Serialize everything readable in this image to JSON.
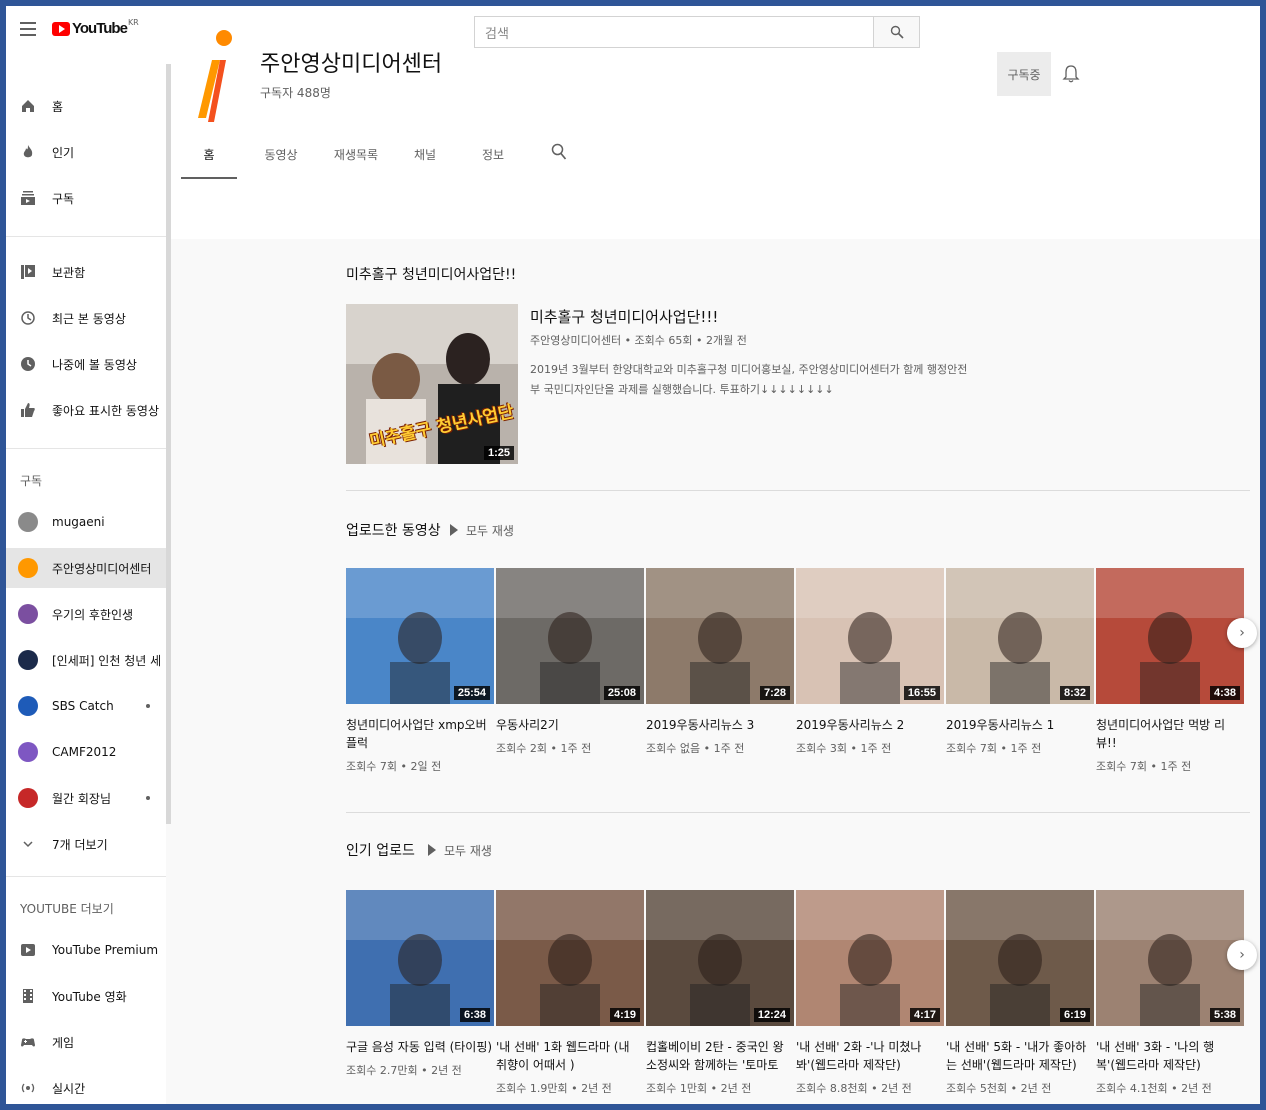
{
  "app": {
    "logo_text": "YouTube",
    "logo_region": "KR"
  },
  "search": {
    "placeholder": "검색"
  },
  "sidebar": {
    "main": [
      {
        "label": "홈",
        "icon": "home-icon"
      },
      {
        "label": "인기",
        "icon": "fire-icon"
      },
      {
        "label": "구독",
        "icon": "subscriptions-icon"
      }
    ],
    "library": [
      {
        "label": "보관함",
        "icon": "library-icon"
      },
      {
        "label": "최근 본 동영상",
        "icon": "history-icon"
      },
      {
        "label": "나중에 볼 동영상",
        "icon": "clock-icon"
      },
      {
        "label": "좋아요 표시한 동영상",
        "icon": "thumbs-up-icon"
      }
    ],
    "subscriptions_header": "구독",
    "subscriptions": [
      {
        "label": "mugaeni",
        "color": "#8a8a8a",
        "dot": false
      },
      {
        "label": "주안영상미디어센터",
        "color": "#ff9800",
        "dot": false
      },
      {
        "label": "우기의 후한인생",
        "color": "#7b4fa0",
        "dot": false
      },
      {
        "label": "[인세퍼] 인천 청년 세...",
        "color": "#1b2a4a",
        "dot": false
      },
      {
        "label": "SBS Catch",
        "color": "#1e5bb8",
        "dot": true
      },
      {
        "label": "CAMF2012",
        "color": "#7e57c2",
        "dot": false
      },
      {
        "label": "월간 회장님",
        "color": "#c62828",
        "dot": true
      }
    ],
    "show_more": "7개 더보기",
    "more_header": "YOUTUBE 더보기",
    "more": [
      {
        "label": "YouTube Premium",
        "icon": "youtube-premium-icon"
      },
      {
        "label": "YouTube 영화",
        "icon": "film-icon"
      },
      {
        "label": "게임",
        "icon": "gamepad-icon"
      },
      {
        "label": "실시간",
        "icon": "live-icon"
      }
    ]
  },
  "channel": {
    "name": "주안영상미디어센터",
    "subscribers": "구독자 488명",
    "subscribe_label": "구독중",
    "tabs": [
      "홈",
      "동영상",
      "재생목록",
      "채널",
      "정보"
    ]
  },
  "featured": {
    "section_title": "미추홀구 청년미디어사업단!!",
    "title": "미추홀구 청년미디어사업단!!!",
    "meta": "주안영상미디어센터 • 조회수 65회 • 2개월 전",
    "desc": "2019년 3월부터 한양대학교와 미추홀구청 미디어홍보실, 주안영상미디어센터가 함께 행정안전부 국민디자인단을 과제를 실행했습니다. 투표하기↓↓↓↓↓↓↓↓",
    "duration": "1:25",
    "overlay_text": "미추홀구 청년사업단"
  },
  "uploads": {
    "title": "업로드한 동영상",
    "play_all": "모두 재생",
    "videos": [
      {
        "title": "청년미디어사업단 xmp오버플럭",
        "meta": "조회수 7회 • 2일 전",
        "duration": "25:54",
        "color": "#4a86c8"
      },
      {
        "title": "우동사리2기",
        "meta": "조회수 2회 • 1주 전",
        "duration": "25:08",
        "color": "#6d6a66"
      },
      {
        "title": "2019우동사리뉴스 3",
        "meta": "조회수 없음 • 1주 전",
        "duration": "7:28",
        "color": "#8d7a6a"
      },
      {
        "title": "2019우동사리뉴스 2",
        "meta": "조회수 3회 • 1주 전",
        "duration": "16:55",
        "color": "#d8c2b4"
      },
      {
        "title": "2019우동사리뉴스 1",
        "meta": "조회수 7회 • 1주 전",
        "duration": "8:32",
        "color": "#c9b9a8"
      },
      {
        "title": "청년미디어사업단 먹방 리뷰!!",
        "meta": "조회수 7회 • 1주 전",
        "duration": "4:38",
        "color": "#b64a3a"
      }
    ]
  },
  "popular": {
    "title": "인기 업로드",
    "play_all": "모두 재생",
    "videos": [
      {
        "title": "구글 음성 자동 입력 (타이핑)",
        "meta": "조회수 2.7만회 • 2년 전",
        "duration": "6:38",
        "color": "#3f6fb0"
      },
      {
        "title": "'내 선배' 1화 웹드라마 (내 취향이 어때서 )",
        "meta": "조회수 1.9만회 • 2년 전",
        "duration": "4:19",
        "color": "#7a5a48"
      },
      {
        "title": "컵홀베이비 2탄 - 중국인 왕소정씨와 함께하는 '토마토계...",
        "meta": "조회수 1만회 • 2년 전",
        "duration": "12:24",
        "color": "#5a4a3e"
      },
      {
        "title": "'내 선배' 2화 -'나 미쳤나 봐'(웹드라마 제작단)",
        "meta": "조회수 8.8천회 • 2년 전",
        "duration": "4:17",
        "color": "#b08672"
      },
      {
        "title": "'내 선배' 5화 - '내가 좋아하는 선배'(웹드라마 제작단)",
        "meta": "조회수 5천회 • 2년 전",
        "duration": "6:19",
        "color": "#6e5a4a"
      },
      {
        "title": "'내 선배' 3화 - '나의 행복'(웹드라마 제작단)",
        "meta": "조회수 4.1천회 • 2년 전",
        "duration": "5:38",
        "color": "#9c8272"
      }
    ]
  }
}
